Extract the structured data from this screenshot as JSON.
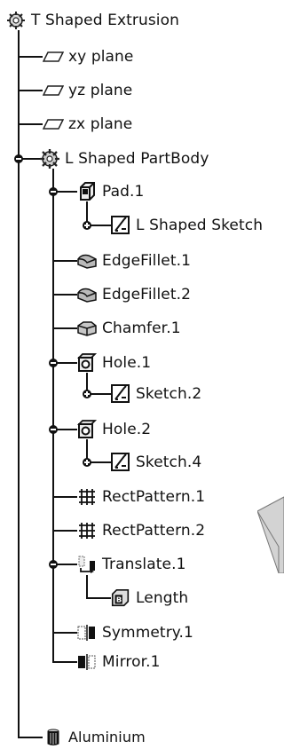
{
  "tree": {
    "root": {
      "label": "T Shaped Extrusion",
      "icon": "gear-icon"
    },
    "planes": [
      {
        "label": "xy plane",
        "icon": "plane-icon"
      },
      {
        "label": "yz plane",
        "icon": "plane-icon"
      },
      {
        "label": "zx plane",
        "icon": "plane-icon"
      }
    ],
    "body": {
      "label": "L Shaped PartBody",
      "icon": "gear-icon"
    },
    "items": [
      {
        "label": "Pad.1",
        "icon": "pad-icon"
      },
      {
        "label": "L Shaped Sketch",
        "icon": "sketch-icon"
      },
      {
        "label": "EdgeFillet.1",
        "icon": "fillet-icon"
      },
      {
        "label": "EdgeFillet.2",
        "icon": "fillet-icon"
      },
      {
        "label": "Chamfer.1",
        "icon": "chamfer-icon"
      },
      {
        "label": "Hole.1",
        "icon": "hole-icon"
      },
      {
        "label": "Sketch.2",
        "icon": "sketch-icon"
      },
      {
        "label": "Hole.2",
        "icon": "hole-icon"
      },
      {
        "label": "Sketch.4",
        "icon": "sketch-icon"
      },
      {
        "label": "RectPattern.1",
        "icon": "pattern-icon"
      },
      {
        "label": "RectPattern.2",
        "icon": "pattern-icon"
      },
      {
        "label": "Translate.1",
        "icon": "translate-icon"
      },
      {
        "label": "Length",
        "icon": "parameter-icon"
      },
      {
        "label": "Symmetry.1",
        "icon": "symmetry-icon"
      },
      {
        "label": "Mirror.1",
        "icon": "mirror-icon"
      }
    ],
    "material": {
      "label": "Aluminium",
      "icon": "material-icon"
    }
  },
  "colors": {
    "tree_line": "#111111",
    "icon_gray": "#b9b9b9"
  }
}
